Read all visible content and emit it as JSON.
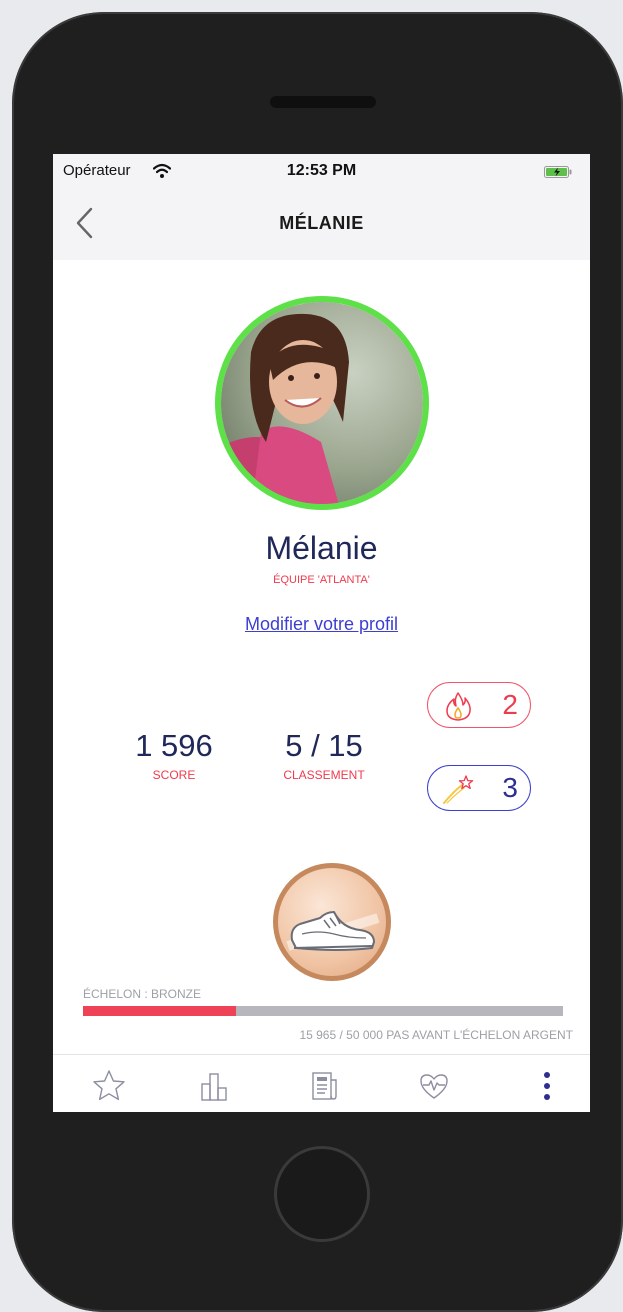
{
  "status_bar": {
    "carrier": "Opérateur",
    "time": "12:53 PM"
  },
  "nav": {
    "title": "MÉLANIE",
    "back_icon": "chevron-left-icon"
  },
  "profile": {
    "name": "Mélanie",
    "team": "ÉQUIPE 'ATLANTA'",
    "edit_link": "Modifier votre profil",
    "ring_color": "#5ee049"
  },
  "stats": {
    "score": {
      "value": "1 596",
      "label": "SCORE"
    },
    "rank": {
      "value": "5 / 15",
      "label": "CLASSEMENT"
    }
  },
  "badges": {
    "streak": {
      "count": "2",
      "icon": "flame-icon",
      "color": "#ef3b4e"
    },
    "stars": {
      "count": "3",
      "icon": "shooting-star-icon",
      "color": "#2d2f8f"
    }
  },
  "level": {
    "label": "ÉCHELON : BRONZE",
    "progress_caption": "15 965 / 50 000 PAS AVANT L'ÉCHELON ARGENT",
    "steps_done": 15965,
    "steps_goal": 50000,
    "medal_icon": "sneaker-icon",
    "fill_color": "#ee4257"
  },
  "tabs": [
    {
      "name": "favorites",
      "icon": "star-icon"
    },
    {
      "name": "leaderboard",
      "icon": "bar-chart-icon"
    },
    {
      "name": "news",
      "icon": "newspaper-icon"
    },
    {
      "name": "health",
      "icon": "heart-pulse-icon"
    },
    {
      "name": "more",
      "icon": "more-vertical-icon"
    }
  ]
}
